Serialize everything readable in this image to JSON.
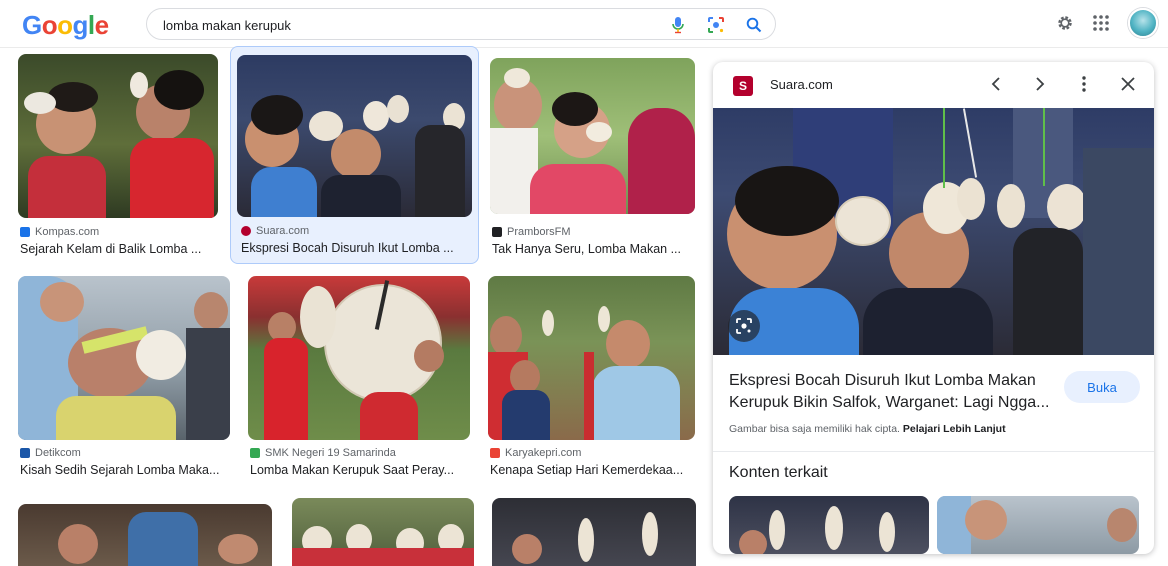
{
  "header": {
    "logo": {
      "letters": [
        "G",
        "o",
        "o",
        "g",
        "l",
        "e"
      ],
      "colors": [
        "#4285f4",
        "#ea4335",
        "#fbbc05",
        "#4285f4",
        "#34a853",
        "#ea4335"
      ]
    },
    "search": {
      "query": "lomba makan kerupuk"
    },
    "icons": [
      "mic-icon",
      "lens-icon",
      "search-icon"
    ],
    "right_icons": [
      "gear-icon",
      "apps-grid-icon",
      "account-avatar"
    ]
  },
  "results": [
    {
      "source": "Kompas.com",
      "title": "Sejarah Kelam di Balik Lomba ...",
      "fav_color": "#1a73e8"
    },
    {
      "source": "Suara.com",
      "title": "Ekspresi Bocah Disuruh Ikut Lomba ...",
      "fav_color": "#b3002d",
      "selected": true
    },
    {
      "source": "PramborsFM",
      "title": "Tak Hanya Seru, Lomba Makan ...",
      "fav_color": "#202124"
    },
    {
      "source": "Detikcom",
      "title": "Kisah Sedih Sejarah Lomba Maka...",
      "fav_color": "#1a56a8"
    },
    {
      "source": "SMK Negeri 19 Samarinda",
      "title": "Lomba Makan Kerupuk Saat Peray...",
      "fav_color": "#34a853"
    },
    {
      "source": "Karyakepri.com",
      "title": "Kenapa Setiap Hari Kemerdekaa...",
      "fav_color": "#ea4335"
    }
  ],
  "panel": {
    "source": "Suara.com",
    "fav_letter": "S",
    "title": "Ekspresi Bocah Disuruh Ikut Lomba Makan Kerupuk Bikin Salfok, Warganet: Lagi Ngga...",
    "open_button": "Buka",
    "note": "Gambar bisa saja memiliki hak cipta.",
    "note_link": "Pelajari Lebih Lanjut",
    "related_heading": "Konten terkait"
  }
}
